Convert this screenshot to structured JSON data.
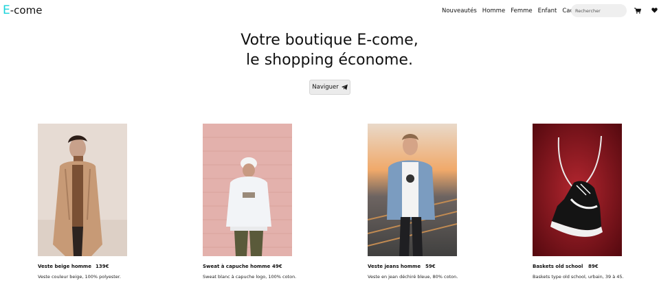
{
  "brand": {
    "first_letter": "E",
    "rest": "-come",
    "accent_color": "#19d3da"
  },
  "nav": {
    "links": [
      "Nouveautés",
      "Homme",
      "Femme",
      "Enfant",
      "Cadeaux"
    ],
    "search_placeholder": "Rechercher",
    "cart_icon": "cart-icon",
    "heart_icon": "heart-icon"
  },
  "hero": {
    "title_line1": "Votre boutique E-come,",
    "title_line2": "le shopping économe.",
    "button_label": "Naviguer",
    "button_icon": "paper-plane-icon"
  },
  "products": [
    {
      "name": "Veste beige homme",
      "price": "139€",
      "description": "Veste couleur beige, 100% polyester."
    },
    {
      "name": "Sweat à capuche homme",
      "price": "49€",
      "description": "Sweat blanc à capuche logo, 100% coton."
    },
    {
      "name": "Veste jeans homme",
      "price": "59€",
      "description": "Veste en jean déchiré bleue, 80% coton."
    },
    {
      "name": "Baskets old school",
      "price": "89€",
      "description": "Baskets type old school, urbain, 39 à 45."
    }
  ]
}
